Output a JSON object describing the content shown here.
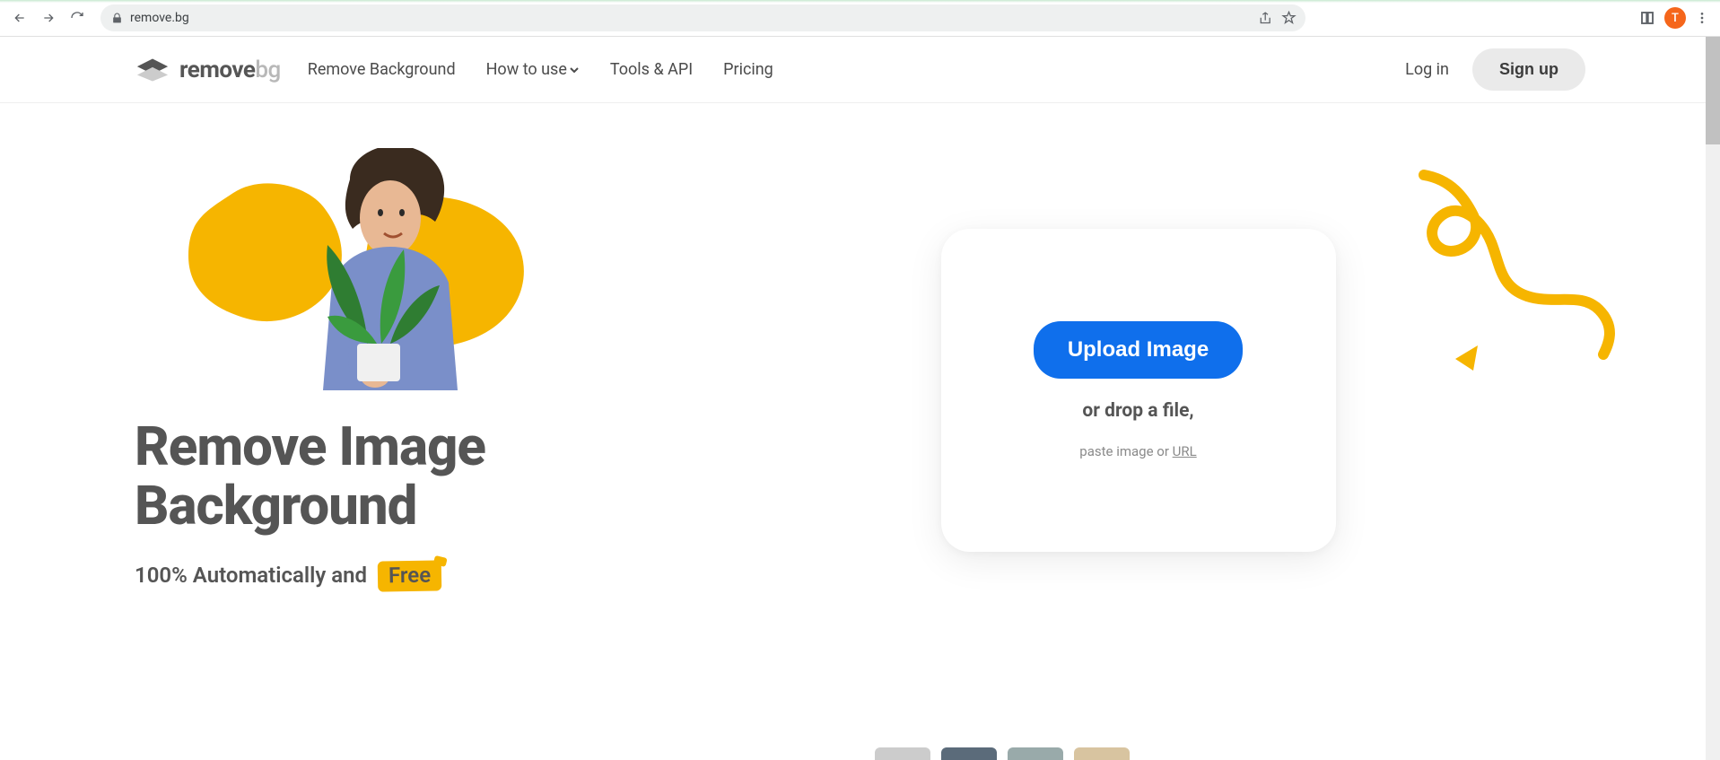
{
  "browser": {
    "url": "remove.bg",
    "avatar_letter": "T"
  },
  "header": {
    "logo_remove": "remove",
    "logo_bg": "bg",
    "nav": {
      "remove_background": "Remove Background",
      "how_to_use": "How to use",
      "tools_api": "Tools & API",
      "pricing": "Pricing"
    },
    "login": "Log in",
    "signup": "Sign up"
  },
  "hero": {
    "headline_l1": "Remove Image",
    "headline_l2": "Background",
    "subline_prefix": "100% Automatically and",
    "subline_badge": "Free"
  },
  "upload": {
    "button": "Upload Image",
    "drop": "or drop a file,",
    "paste_prefix": "paste image or ",
    "paste_url": "URL"
  }
}
